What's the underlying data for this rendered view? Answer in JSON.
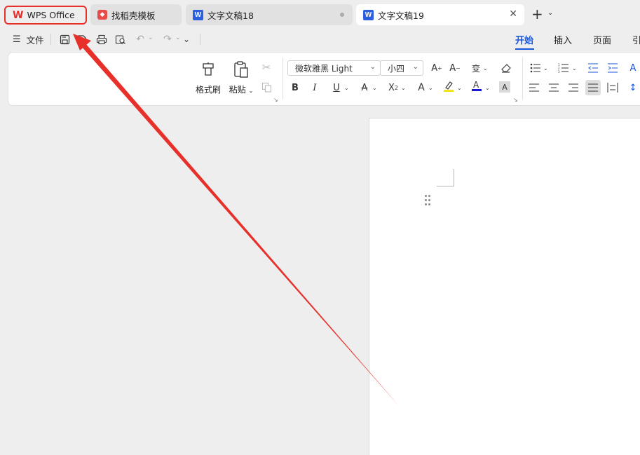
{
  "tabs": [
    {
      "label": "WPS Office",
      "icon": "wps-logo-icon"
    },
    {
      "label": "找稻壳模板",
      "icon": "daoke-logo-icon"
    },
    {
      "label": "文字文稿18",
      "icon": "writer-doc-icon"
    },
    {
      "label": "文字文稿19",
      "icon": "writer-doc-icon"
    }
  ],
  "new_tab_symbol": "+",
  "menu": {
    "file_label": "文件"
  },
  "nav_tabs": [
    "开始",
    "插入",
    "页面",
    "引"
  ],
  "ribbon": {
    "format_painter_label": "格式刷",
    "paste_label": "粘贴",
    "font_name": "微软雅黑 Light",
    "font_size": "小四"
  },
  "colors": {
    "accent": "#1a56db",
    "annotation": "#e8302a",
    "highlight": "#f5e11f",
    "font_color": "#1a1ad6"
  }
}
